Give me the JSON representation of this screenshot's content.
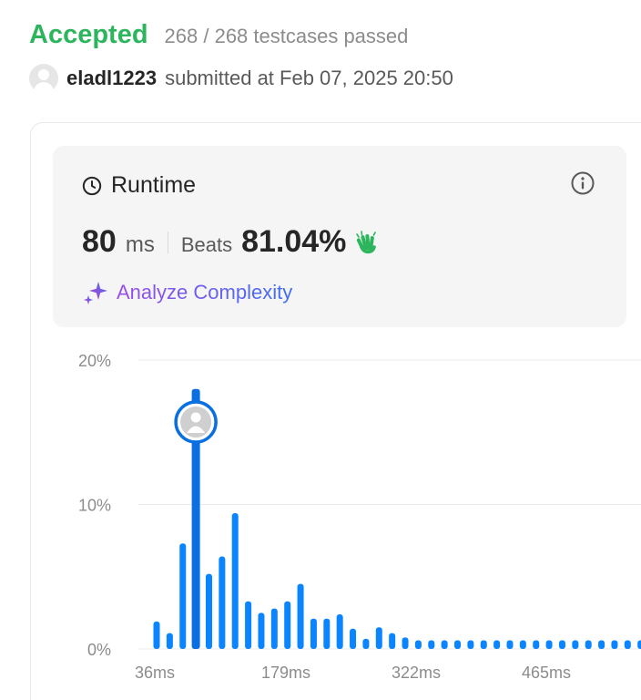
{
  "header": {
    "status": "Accepted",
    "testcases": "268 / 268 testcases passed"
  },
  "submission": {
    "username": "eladl1223",
    "submitted_text": "submitted at Feb 07, 2025 20:50"
  },
  "runtime": {
    "title": "Runtime",
    "value": "80",
    "unit": "ms",
    "beats_label": "Beats",
    "beats_value": "81.04%",
    "analyze_label": "Analyze Complexity"
  },
  "colors": {
    "accepted": "#2db55d",
    "bar": "#0a84ff",
    "selected_bar": "#0a6fe0"
  },
  "icons": {
    "clock": "clock-icon",
    "info": "info-icon",
    "clap": "clap-icon",
    "sparkle": "sparkle-icon",
    "avatar": "avatar-icon"
  },
  "chart_data": {
    "type": "bar",
    "ylabel": "",
    "xlabel": "",
    "ylim": [
      0,
      20
    ],
    "y_ticks": [
      "0%",
      "10%",
      "20%"
    ],
    "x_ticks": [
      "36ms",
      "179ms",
      "322ms",
      "465ms"
    ],
    "selected_index": 3,
    "values": [
      1.9,
      1.1,
      7.3,
      18.0,
      5.2,
      6.4,
      9.4,
      3.3,
      2.5,
      2.8,
      3.3,
      4.5,
      2.1,
      2.1,
      2.4,
      1.4,
      0.7,
      1.5,
      1.1,
      0.8,
      0.6,
      0.6,
      0.6,
      0.6,
      0.6,
      0.6,
      0.6,
      0.6,
      0.6,
      0.6,
      0.6,
      0.6,
      0.6,
      0.6,
      0.6,
      0.6,
      0.6,
      0.6,
      0.6
    ]
  }
}
